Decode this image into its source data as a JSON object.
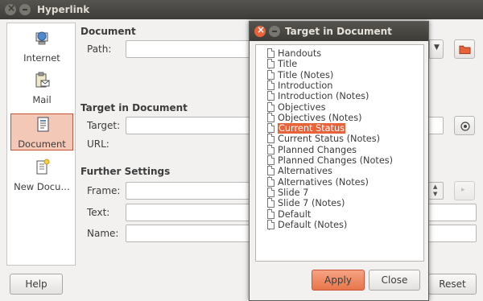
{
  "main_window": {
    "title": "Hyperlink",
    "sidebar": [
      {
        "label": "Internet",
        "icon": "globe-monitor-icon",
        "selected": false
      },
      {
        "label": "Mail",
        "icon": "mail-clipboard-icon",
        "selected": false
      },
      {
        "label": "Document",
        "icon": "document-icon",
        "selected": true
      },
      {
        "label": "New Docu…",
        "icon": "new-document-icon",
        "selected": false
      }
    ],
    "document_section": {
      "heading": "Document",
      "path_label": "Path:",
      "path_value": ""
    },
    "target_section": {
      "heading": "Target in Document",
      "target_label": "Target:",
      "target_value": "",
      "url_label": "URL:",
      "url_value": ""
    },
    "further_section": {
      "heading": "Further Settings",
      "frame_label": "Frame:",
      "frame_value": "",
      "text_label": "Text:",
      "text_value": "",
      "name_label": "Name:",
      "name_value": ""
    },
    "help_button": "Help",
    "reset_button": "Reset"
  },
  "dialog": {
    "title": "Target in Document",
    "items": [
      "Handouts",
      "Title",
      "Title (Notes)",
      "Introduction",
      "Introduction (Notes)",
      "Objectives",
      "Objectives (Notes)",
      "Current Status",
      "Current Status (Notes)",
      "Planned Changes",
      "Planned Changes (Notes)",
      "Alternatives",
      "Alternatives (Notes)",
      "Slide 7",
      "Slide 7 (Notes)",
      "Default",
      "Default (Notes)"
    ],
    "selected_index": 7,
    "apply_button": "Apply",
    "close_button": "Close"
  },
  "colors": {
    "accent": "#e8623a",
    "window_bg": "#f2f1f0",
    "titlebar": "#3c3b37"
  }
}
